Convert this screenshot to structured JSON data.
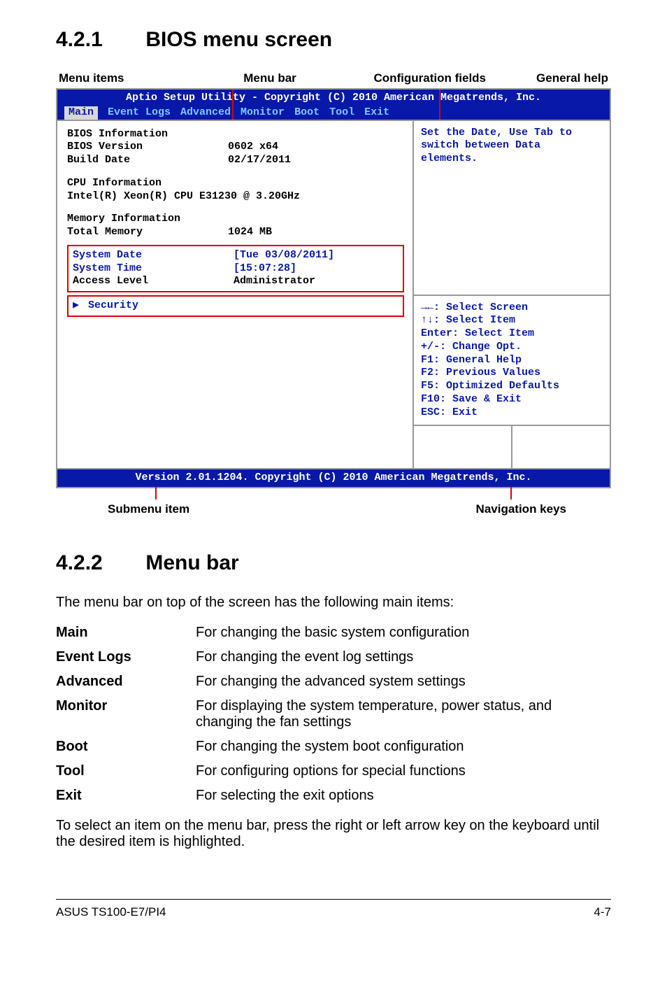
{
  "section1": {
    "num": "4.2.1",
    "title": "BIOS menu screen"
  },
  "annot_top": {
    "menu_items": "Menu items",
    "menu_bar": "Menu bar",
    "config_fields": "Configuration fields",
    "general_help": "General help"
  },
  "bios": {
    "title": "Aptio Setup Utility - Copyright (C) 2010 American Megatrends, Inc.",
    "menus": [
      "Main",
      "Event Logs",
      "Advanced",
      "Monitor",
      "Boot",
      "Tool",
      "Exit"
    ],
    "active_menu": "Main",
    "left": {
      "l1": "BIOS Information",
      "l2k": "BIOS Version",
      "l2v": "0602 x64",
      "l3k": "Build Date",
      "l3v": "02/17/2011",
      "l4": "CPU Information",
      "l5": "Intel(R) Xeon(R) CPU E31230 @ 3.20GHz",
      "l6": "Memory Information",
      "l7k": "Total Memory",
      "l7v": "1024 MB",
      "r1k": "System Date",
      "r1v": "[Tue 03/08/2011]",
      "r2k": "System Time",
      "r2v": "[15:07:28]",
      "r3k": "Access Level",
      "r3v": "Administrator",
      "sec_arrow": "▶",
      "security": "Security"
    },
    "help": {
      "h1": "Set the Date, Use Tab to",
      "h2": "switch between Data elements."
    },
    "nav": {
      "n1": "→←: Select Screen",
      "n2": "↑↓: Select Item",
      "n3": "Enter: Select Item",
      "n4": "+/-: Change Opt.",
      "n5": "F1: General Help",
      "n6": "F2: Previous Values",
      "n7": "F5: Optimized Defaults",
      "n8": "F10: Save & Exit",
      "n9": "ESC: Exit"
    },
    "bottom": "Version 2.01.1204. Copyright (C) 2010 American Megatrends, Inc."
  },
  "annot_bottom": {
    "submenu": "Submenu item",
    "navkeys": "Navigation keys"
  },
  "section2": {
    "num": "4.2.2",
    "title": "Menu bar"
  },
  "p1": "The menu bar on top of the screen has the following main items:",
  "rows": {
    "main_k": "Main",
    "main_v": "For changing the basic system configuration",
    "el_k": "Event Logs",
    "el_v": "For changing the event log settings",
    "adv_k": "Advanced",
    "adv_v": "For changing the advanced system settings",
    "mon_k": "Monitor",
    "mon_v": "For displaying the system temperature, power status, and changing the fan settings",
    "boot_k": "Boot",
    "boot_v": "For changing the system boot configuration",
    "tool_k": "Tool",
    "tool_v": "For configuring options for special functions",
    "exit_k": "Exit",
    "exit_v": "For selecting the exit options"
  },
  "p2": "To select an item on the menu bar, press the right or left arrow key on the keyboard until the desired item is highlighted.",
  "footer": {
    "model": "ASUS TS100-E7/PI4",
    "page": "4-7"
  }
}
